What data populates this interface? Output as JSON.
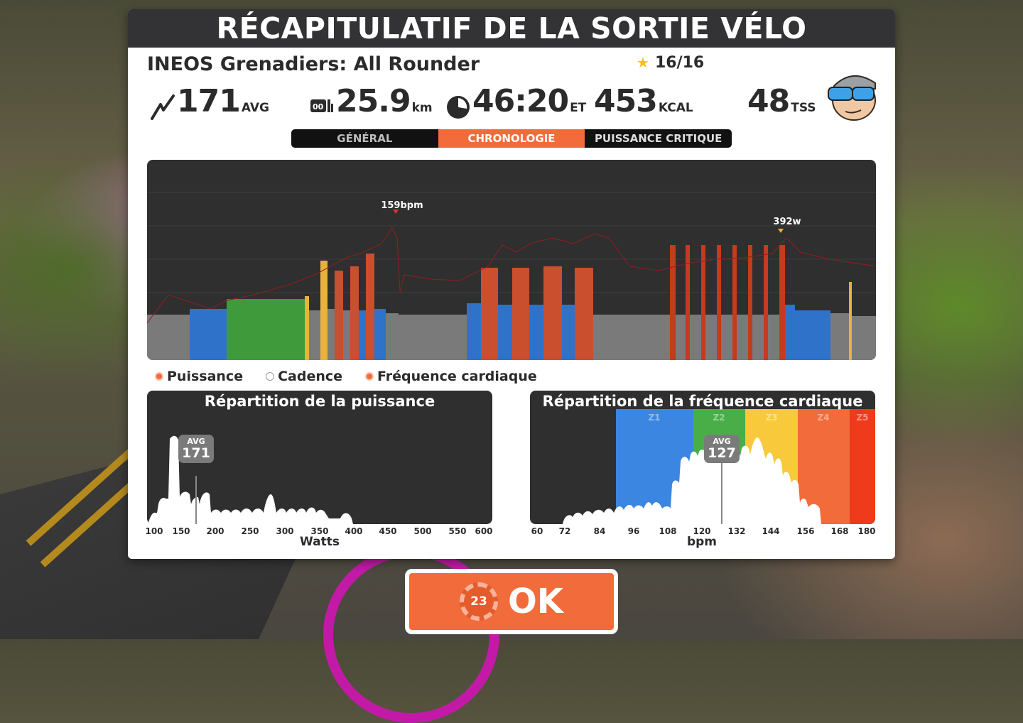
{
  "title": "RÉCAPITULATIF DE LA SORTIE VÉLO",
  "route_name": "INEOS Grenadiers: All Rounder",
  "stars": "16/16",
  "stats": {
    "power": {
      "value": "171",
      "unit": "AVG"
    },
    "distance": {
      "value": "25.9",
      "unit": "km"
    },
    "time": {
      "value": "46:20",
      "unit": "ET"
    },
    "calories": {
      "value": "453",
      "unit": "KCAL"
    },
    "tss": {
      "value": "48",
      "unit": "TSS"
    }
  },
  "tabs": [
    "GÉNÉRAL",
    "CHRONOLOGIE",
    "PUISSANCE CRITIQUE"
  ],
  "active_tab": 1,
  "timeline": {
    "max_hr_label": "159bpm",
    "max_power_label": "392w",
    "zone_colors": {
      "z1": "#7a7a7a",
      "z2": "#2f72c9",
      "z3": "#3f9a3c",
      "z4": "#e9b23a",
      "z5": "#c94f2f",
      "z6": "#c43b1e"
    },
    "hr_color": "#8e1f1f"
  },
  "legend": [
    {
      "label": "Puissance",
      "enabled": true
    },
    {
      "label": "Cadence",
      "enabled": false
    },
    {
      "label": "Fréquence cardiaque",
      "enabled": true
    }
  ],
  "power_hist": {
    "title": "Répartition de la puissance",
    "avg_label": "AVG",
    "avg_value": "171",
    "ticks": [
      "100",
      "150",
      "200",
      "250",
      "300",
      "350",
      "400",
      "450",
      "500",
      "550",
      "600"
    ],
    "axis_label": "Watts"
  },
  "hr_hist": {
    "title": "Répartition de la fréquence cardiaque",
    "avg_label": "AVG",
    "avg_value": "127",
    "zones": [
      "Z1",
      "Z2",
      "Z3",
      "Z4",
      "Z5"
    ],
    "zone_colors": [
      "#3a86e0",
      "#4aae48",
      "#f7c93b",
      "#f26b3a",
      "#ef3a1c"
    ],
    "ticks": [
      "60",
      "72",
      "84",
      "96",
      "108",
      "120",
      "132",
      "144",
      "156",
      "168",
      "180"
    ],
    "axis_label": "bpm"
  },
  "ok_button": {
    "label": "OK",
    "badge": "23"
  }
}
